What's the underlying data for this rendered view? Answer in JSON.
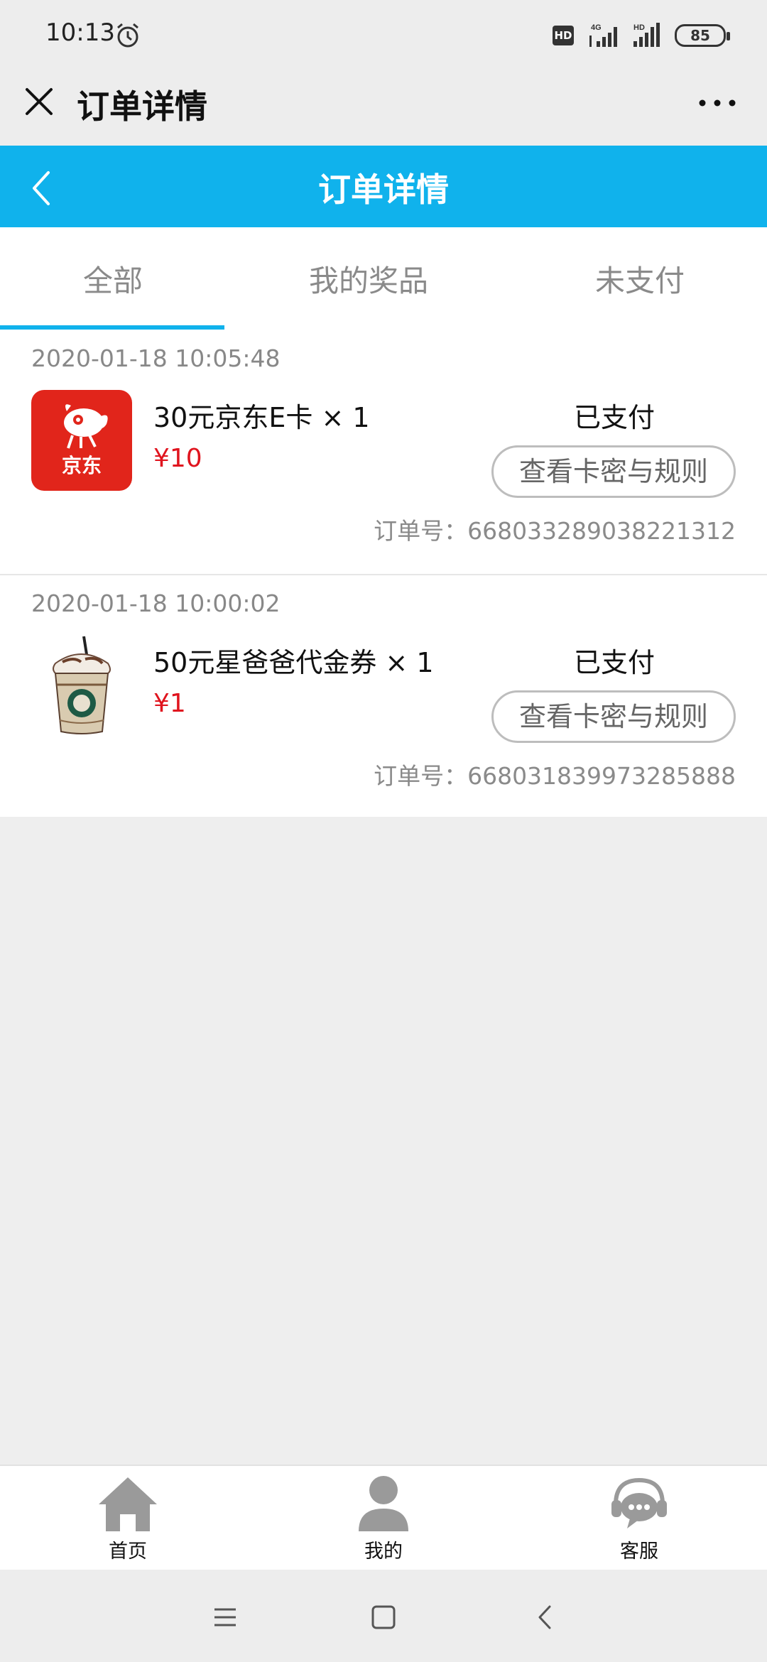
{
  "status_bar": {
    "time": "10:13",
    "hd_label": "HD",
    "network_label": "4G",
    "battery": "85"
  },
  "titlebar": {
    "title": "订单详情"
  },
  "header": {
    "title": "订单详情",
    "accent_color": "#10b2ec"
  },
  "tabs": [
    {
      "label": "全部",
      "active": true
    },
    {
      "label": "我的奖品",
      "active": false
    },
    {
      "label": "未支付",
      "active": false
    }
  ],
  "orders": [
    {
      "date": "2020-01-18 10:05:48",
      "product": "30元京东E卡 × 1",
      "price": "¥10",
      "status": "已支付",
      "button": "查看卡密与规则",
      "order_no": "订单号：668033289038221312",
      "thumb_brand": "京东"
    },
    {
      "date": "2020-01-18 10:00:02",
      "product": "50元星爸爸代金券 × 1",
      "price": "¥1",
      "status": "已支付",
      "button": "查看卡密与规则",
      "order_no": "订单号：668031839973285888",
      "thumb_brand": ""
    }
  ],
  "bottom_nav": [
    {
      "label": "首页",
      "icon": "home-icon"
    },
    {
      "label": "我的",
      "icon": "user-icon"
    },
    {
      "label": "客服",
      "icon": "customer-service-icon"
    }
  ]
}
